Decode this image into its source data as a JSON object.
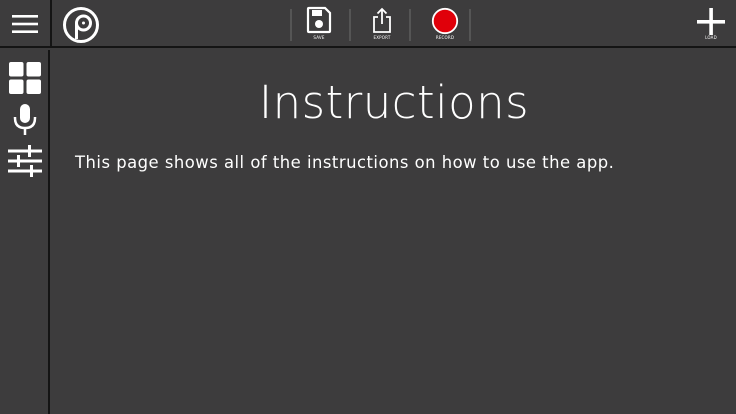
{
  "toolbar": {
    "save_label": "SAVE",
    "export_label": "EXPORT",
    "record_label": "RECORD",
    "load_label": "LOAD"
  },
  "sidebar": {
    "items": [
      {
        "icon": "grid-icon"
      },
      {
        "icon": "microphone-icon"
      },
      {
        "icon": "sliders-icon"
      }
    ]
  },
  "main": {
    "title": "Instructions",
    "body": "This page shows all of the instructions on how to use the app."
  },
  "colors": {
    "background": "#3d3c3d",
    "divider": "#141414",
    "record": "#e0000a",
    "text": "#ffffff"
  }
}
